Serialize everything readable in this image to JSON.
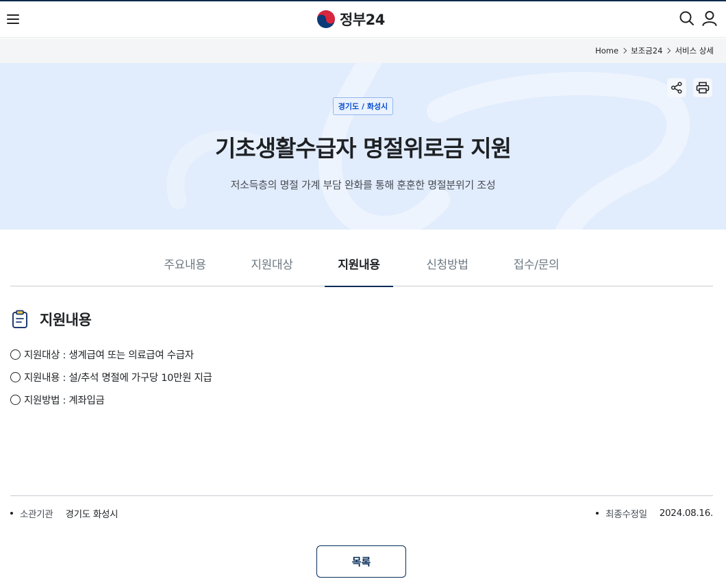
{
  "header": {
    "logo_text": "정부24",
    "menu_icon": "hamburger-icon",
    "search_icon": "search-icon",
    "user_icon": "user-icon"
  },
  "breadcrumb": [
    "Home",
    "보조금24",
    "서비스 상세"
  ],
  "hero": {
    "region": "경기도 / 화성시",
    "title": "기초생활수급자 명절위로금 지원",
    "subtitle": "저소득층의 명절 가계 부담 완화를 통해 훈훈한 명절분위기 조성",
    "share_icon": "share-icon",
    "print_icon": "print-icon"
  },
  "tabs": [
    {
      "label": "주요내용",
      "active": false
    },
    {
      "label": "지원대상",
      "active": false
    },
    {
      "label": "지원내용",
      "active": true
    },
    {
      "label": "신청방법",
      "active": false
    },
    {
      "label": "접수/문의",
      "active": false
    }
  ],
  "section": {
    "icon": "clipboard-icon",
    "title": "지원내용",
    "items": [
      "지원대상 : 생계급여 또는 의료급여 수급자",
      "지원내용 : 설/추석 명절에 가구당 10만원 지급",
      "지원방법 : 계좌입금"
    ]
  },
  "footer": {
    "agency_label": "소관기관",
    "agency_value": "경기도 화성시",
    "updated_label": "최종수정일",
    "updated_value": "2024.08.16."
  },
  "list_button": "목록",
  "colors": {
    "brand_navy": "#052b57",
    "hero_bg": "#e1ecfc",
    "badge_blue": "#0b50d0"
  }
}
